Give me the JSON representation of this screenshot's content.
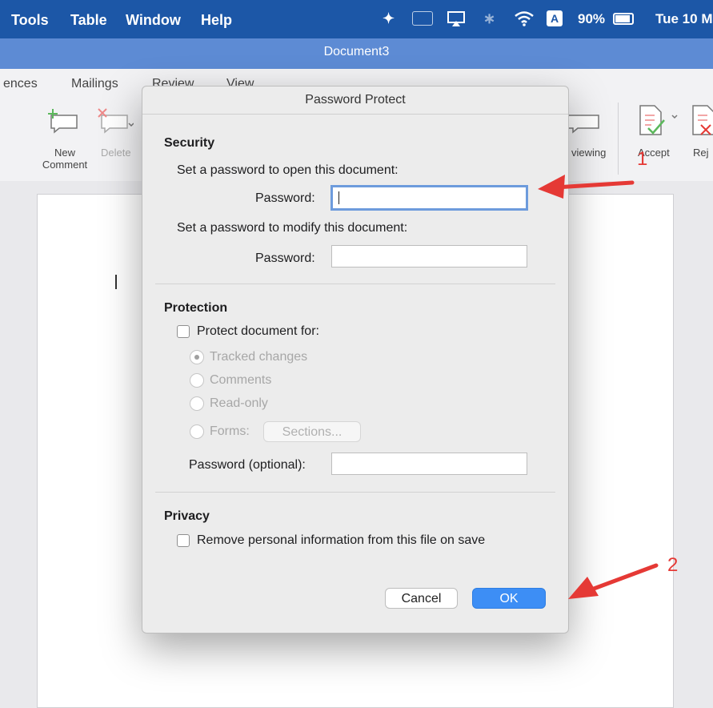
{
  "menu": {
    "items": [
      "Tools",
      "Table",
      "Window",
      "Help"
    ]
  },
  "status": {
    "keyboard": "A",
    "battery": "90%",
    "clock": "Tue 10 M"
  },
  "window": {
    "title": "Document3"
  },
  "ribbon": {
    "tabs": [
      "ences",
      "Mailings",
      "Review",
      "View"
    ],
    "buttons": {
      "new_comment_line1": "New",
      "new_comment_line2": "Comment",
      "delete": "Delete",
      "reviewing": "viewing",
      "accept": "Accept",
      "reject": "Rej"
    }
  },
  "dialog": {
    "title": "Password Protect",
    "security": {
      "heading": "Security",
      "open_desc": "Set a password to open this document:",
      "open_label": "Password:",
      "modify_desc": "Set a password to modify this document:",
      "modify_label": "Password:"
    },
    "protection": {
      "heading": "Protection",
      "protect_label": "Protect document for:",
      "options": [
        "Tracked changes",
        "Comments",
        "Read-only",
        "Forms:"
      ],
      "sections_button": "Sections...",
      "password_optional_label": "Password (optional):"
    },
    "privacy": {
      "heading": "Privacy",
      "remove_info_label": "Remove personal information from this file on save"
    },
    "cancel_label": "Cancel",
    "ok_label": "OK"
  },
  "annotations": {
    "one": "1",
    "two": "2"
  },
  "colors": {
    "accent": "#3d8ef5",
    "arrow": "#e53935",
    "menubar": "#1c57a7",
    "titlebar": "#5d8bd4"
  }
}
